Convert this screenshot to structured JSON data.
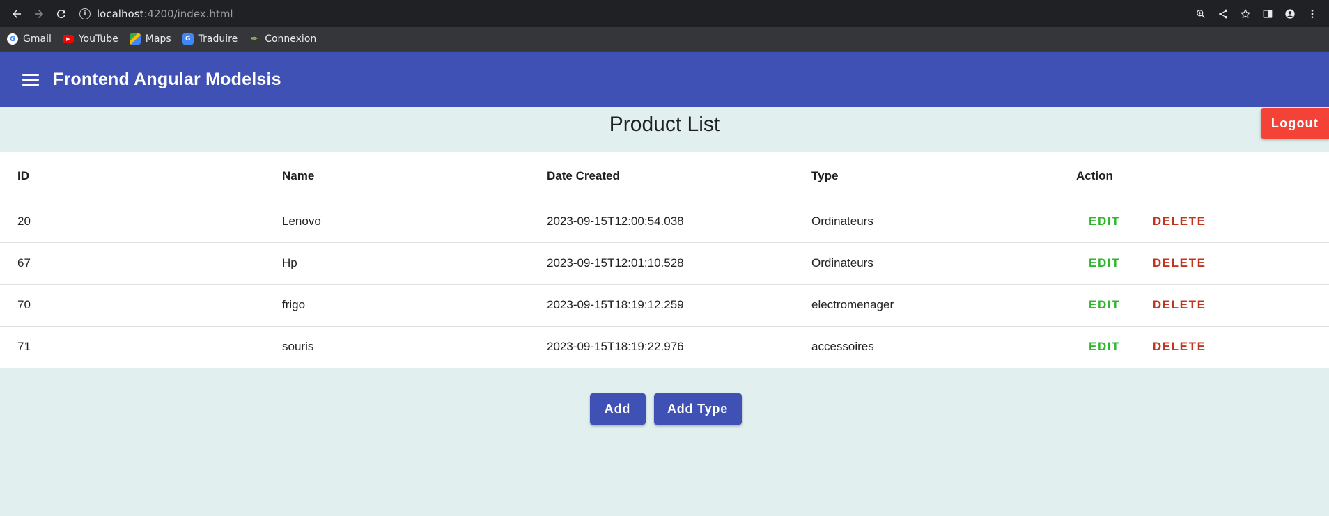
{
  "browser": {
    "url_host": "localhost",
    "url_rest": ":4200/index.html",
    "bookmarks": [
      {
        "label": "Gmail",
        "icon": "google-icon",
        "color": "#ffffff"
      },
      {
        "label": "YouTube",
        "icon": "youtube-icon",
        "color": "#ff0000"
      },
      {
        "label": "Maps",
        "icon": "maps-icon",
        "color": "#34a853"
      },
      {
        "label": "Traduire",
        "icon": "translate-icon",
        "color": "#4285f4"
      },
      {
        "label": "Connexion",
        "icon": "feather-icon",
        "color": "#7cb342"
      }
    ]
  },
  "app": {
    "title": "Frontend Angular Modelsis",
    "accent": "#3f51b5"
  },
  "page": {
    "title": "Product List",
    "logout_label": "Logout"
  },
  "table": {
    "columns": [
      "ID",
      "Name",
      "Date Created",
      "Type",
      "Action"
    ],
    "rows": [
      {
        "id": "20",
        "name": "Lenovo",
        "date": "2023-09-15T12:00:54.038",
        "type": "Ordinateurs"
      },
      {
        "id": "67",
        "name": "Hp",
        "date": "2023-09-15T12:01:10.528",
        "type": "Ordinateurs"
      },
      {
        "id": "70",
        "name": "frigo",
        "date": "2023-09-15T18:19:12.259",
        "type": "electromenager"
      },
      {
        "id": "71",
        "name": "souris",
        "date": "2023-09-15T18:19:22.976",
        "type": "accessoires"
      }
    ],
    "edit_label": "EDIT",
    "delete_label": "DELETE"
  },
  "actions": {
    "add_label": "Add",
    "add_type_label": "Add Type"
  }
}
